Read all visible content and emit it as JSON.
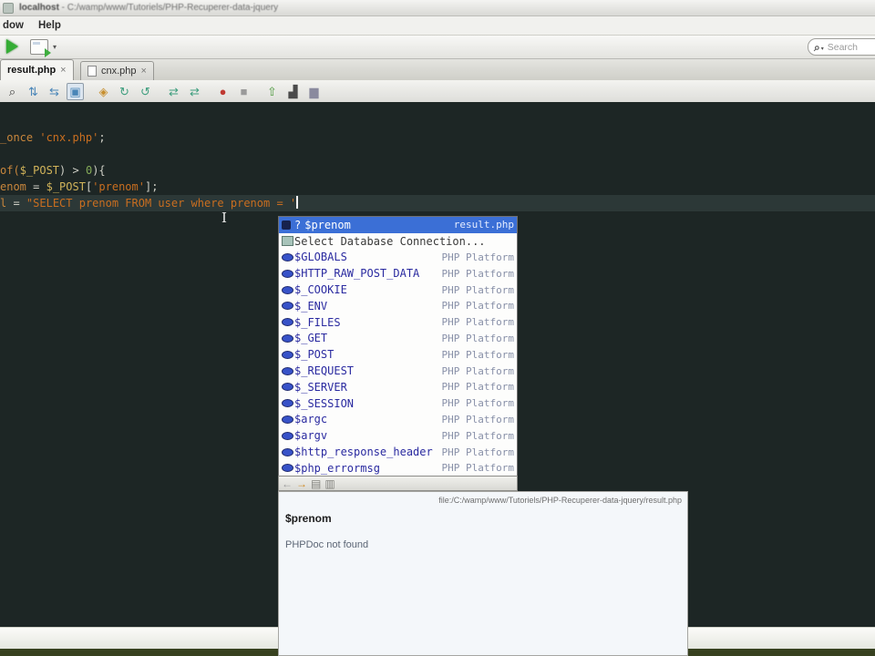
{
  "window": {
    "title_host": "localhost",
    "title_path": " - C:/wamp/www/Tutoriels/PHP-Recuperer-data-jquery",
    "menu": [
      "dow",
      "Help"
    ],
    "search_placeholder": "Search"
  },
  "tabs": [
    {
      "label": "result.php",
      "close": "×",
      "active": true
    },
    {
      "label": "cnx.php",
      "close": "×",
      "active": false
    }
  ],
  "toolbar2_icons": [
    {
      "name": "search-icon",
      "glyph": "⌕",
      "color": "#3a3a3a",
      "gap": false,
      "pressed": false
    },
    {
      "name": "sync-files-icon",
      "glyph": "⇅",
      "color": "#4a86b8",
      "gap": false,
      "pressed": false
    },
    {
      "name": "compare-files-icon",
      "glyph": "⇆",
      "color": "#4a86b8",
      "gap": false,
      "pressed": false
    },
    {
      "name": "web-preview-icon",
      "glyph": "▣",
      "color": "#4a86b8",
      "gap": false,
      "pressed": true
    },
    {
      "name": "key-icon",
      "glyph": "◈",
      "color": "#c89030",
      "gap": true,
      "pressed": false
    },
    {
      "name": "refresh-icon",
      "glyph": "↻",
      "color": "#3e9e7e",
      "gap": false,
      "pressed": false
    },
    {
      "name": "run-script-icon",
      "glyph": "↺",
      "color": "#3e9e7e",
      "gap": false,
      "pressed": false
    },
    {
      "name": "import-icon",
      "glyph": "⇄",
      "color": "#3e9e7e",
      "gap": true,
      "pressed": false
    },
    {
      "name": "export-icon",
      "glyph": "⇄",
      "color": "#3e9e7e",
      "gap": false,
      "pressed": false
    },
    {
      "name": "record-icon",
      "glyph": "●",
      "color": "#c03a32",
      "gap": true,
      "pressed": false
    },
    {
      "name": "stop-icon",
      "glyph": "■",
      "color": "#9a9a9a",
      "gap": false,
      "pressed": false
    },
    {
      "name": "commit-icon",
      "glyph": "⇧",
      "color": "#4e9a3e",
      "gap": true,
      "pressed": false
    },
    {
      "name": "console-icon",
      "glyph": "▟",
      "color": "#4a4a4a",
      "gap": false,
      "pressed": false
    },
    {
      "name": "lock-icon",
      "glyph": "▆",
      "color": "#8a8a9e",
      "gap": false,
      "pressed": false
    }
  ],
  "editor": {
    "lines": [
      {
        "cur": false,
        "segments": [
          {
            "t": "_once ",
            "c": "kw"
          },
          {
            "t": "'cnx.php'",
            "c": "str"
          },
          {
            "t": ";",
            "c": "pln"
          }
        ]
      },
      {
        "cur": false,
        "segments": []
      },
      {
        "cur": false,
        "segments": [
          {
            "t": "of(",
            "c": "kw"
          },
          {
            "t": "$_POST",
            "c": "var"
          },
          {
            "t": ") > ",
            "c": "pln"
          },
          {
            "t": "0",
            "c": "num"
          },
          {
            "t": "){",
            "c": "pln"
          }
        ]
      },
      {
        "cur": false,
        "segments": [
          {
            "t": "enom",
            "c": "kw"
          },
          {
            "t": " = ",
            "c": "pln"
          },
          {
            "t": "$_POST",
            "c": "var"
          },
          {
            "t": "[",
            "c": "pln"
          },
          {
            "t": "'prenom'",
            "c": "str"
          },
          {
            "t": "];",
            "c": "pln"
          }
        ]
      },
      {
        "cur": true,
        "caret": true,
        "segments": [
          {
            "t": "l",
            "c": "kw"
          },
          {
            "t": " = ",
            "c": "pln"
          },
          {
            "t": "\"SELECT prenom FROM user where prenom = '",
            "c": "str"
          }
        ]
      }
    ]
  },
  "completion": {
    "rows": [
      {
        "icon": "field",
        "prefix": "?",
        "label": "$prenom",
        "right": "result.php",
        "selected": true,
        "action": false
      },
      {
        "icon": "db",
        "prefix": "",
        "label": "Select Database Connection...",
        "right": "",
        "selected": false,
        "action": true
      },
      {
        "icon": "var",
        "prefix": "",
        "label": "$GLOBALS",
        "right": "PHP Platform",
        "selected": false,
        "action": false
      },
      {
        "icon": "var",
        "prefix": "",
        "label": "$HTTP_RAW_POST_DATA",
        "right": "PHP Platform",
        "selected": false,
        "action": false
      },
      {
        "icon": "var",
        "prefix": "",
        "label": "$_COOKIE",
        "right": "PHP Platform",
        "selected": false,
        "action": false
      },
      {
        "icon": "var",
        "prefix": "",
        "label": "$_ENV",
        "right": "PHP Platform",
        "selected": false,
        "action": false
      },
      {
        "icon": "var",
        "prefix": "",
        "label": "$_FILES",
        "right": "PHP Platform",
        "selected": false,
        "action": false
      },
      {
        "icon": "var",
        "prefix": "",
        "label": "$_GET",
        "right": "PHP Platform",
        "selected": false,
        "action": false
      },
      {
        "icon": "var",
        "prefix": "",
        "label": "$_POST",
        "right": "PHP Platform",
        "selected": false,
        "action": false
      },
      {
        "icon": "var",
        "prefix": "",
        "label": "$_REQUEST",
        "right": "PHP Platform",
        "selected": false,
        "action": false
      },
      {
        "icon": "var",
        "prefix": "",
        "label": "$_SERVER",
        "right": "PHP Platform",
        "selected": false,
        "action": false
      },
      {
        "icon": "var",
        "prefix": "",
        "label": "$_SESSION",
        "right": "PHP Platform",
        "selected": false,
        "action": false
      },
      {
        "icon": "var",
        "prefix": "",
        "label": "$argc",
        "right": "PHP Platform",
        "selected": false,
        "action": false
      },
      {
        "icon": "var",
        "prefix": "",
        "label": "$argv",
        "right": "PHP Platform",
        "selected": false,
        "action": false
      },
      {
        "icon": "var",
        "prefix": "",
        "label": "$http_response_header",
        "right": "PHP Platform",
        "selected": false,
        "action": false
      },
      {
        "icon": "var",
        "prefix": "",
        "label": "$php_errormsg",
        "right": "PHP Platform",
        "selected": false,
        "action": false
      }
    ],
    "footer_icons": [
      {
        "name": "back-icon",
        "glyph": "←",
        "color": "#9a9a9a"
      },
      {
        "name": "forward-icon",
        "glyph": "→",
        "color": "#d08820"
      },
      {
        "name": "show-source-icon",
        "glyph": "▤",
        "color": "#83837f"
      },
      {
        "name": "open-in-editor-icon",
        "glyph": "▥",
        "color": "#83837f"
      }
    ]
  },
  "doc": {
    "path": "file:/C:/wamp/www/Tutoriels/PHP-Recuperer-data-jquery/result.php",
    "term": "$prenom",
    "message": "PHPDoc not found"
  }
}
